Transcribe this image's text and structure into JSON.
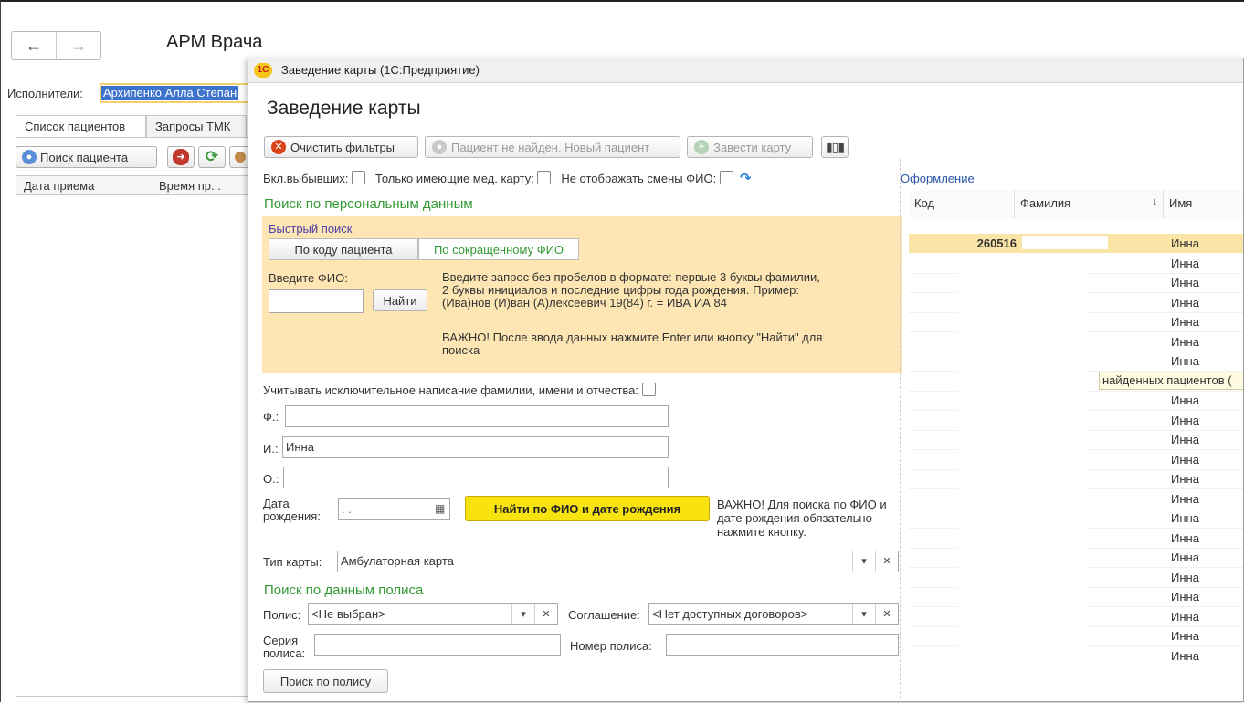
{
  "main": {
    "nav": {
      "back": "←",
      "forward": "→"
    },
    "title": "АРМ Врача",
    "executor": {
      "label": "Исполнители:",
      "value": "Архипенко Алла Степан"
    },
    "tabs": [
      "Список пациентов",
      "Запросы ТМК"
    ],
    "toolbar": {
      "find_patient": "Поиск пациента"
    },
    "grid": {
      "columns": [
        "Дата приема",
        "Время пр..."
      ]
    }
  },
  "dialog": {
    "window_title": "Заведение карты (1С:Предприятие)",
    "logo": "1С",
    "heading": "Заведение карты",
    "toolbar": {
      "clear_filters": "Очистить фильтры",
      "new_patient": "Пациент не найден. Новый пациент",
      "create_card": "Завести карту"
    },
    "filters": {
      "include_dropouts": "Вкл.выбывших:",
      "only_with_card": "Только имеющие мед. карту:",
      "hide_name_changes": "Не отображать смены ФИО:"
    },
    "personal_section": "Поиск по персональным данным",
    "quick_search": {
      "title": "Быстрый поиск",
      "tab_by_code": "По коду пациента",
      "tab_by_short_name": "По сокращенному ФИО",
      "enter_label": "Введите ФИО:",
      "find_button": "Найти",
      "hint": "Введите запрос без пробелов в формате: первые 3 буквы фамилии, 2 буквы инициалов и последние цифры года рождения. Пример: (Ива)нов (И)ван (А)лексеевич 19(84) г. = ИВА ИА 84",
      "important": "ВАЖНО! После ввода данных нажмите Enter или кнопку \"Найти\" для поиска"
    },
    "exact_spelling": "Учитывать исключительное написание фамилии, имени и отчества:",
    "fields": {
      "surname_label": "Ф.:",
      "surname_value": "",
      "name_label": "И.:",
      "name_value": "Инна",
      "patronymic_label": "О.:",
      "patronymic_value": ""
    },
    "birth": {
      "label": "Дата рождения:",
      "placeholder": " .  .",
      "search_button": "Найти по ФИО и дате рождения",
      "note": "ВАЖНО! Для поиска по ФИО и дате рождения обязательно нажмите кнопку."
    },
    "card_type": {
      "label": "Тип карты:",
      "value": "Амбулаторная карта"
    },
    "policy_section": "Поиск по данным полиса",
    "policy": {
      "label": "Полис:",
      "value": "<Не выбран>",
      "agreement_label": "Соглашение:",
      "agreement_value": "<Нет доступных договоров>",
      "series_label": "Серия полиса:",
      "number_label": "Номер полиса:",
      "search_button": "Поиск по полису"
    },
    "results": {
      "design_link": "Оформление",
      "columns": [
        "Код",
        "Фамилия",
        "Имя"
      ],
      "first_code": "260516",
      "names": [
        "Инна",
        "Инна",
        "Инна",
        "Инна",
        "Инна",
        "Инна",
        "Инна",
        "Инна",
        "Инна",
        "Инна",
        "Инна",
        "Инна",
        "Инна",
        "Инна",
        "Инна",
        "Инна",
        "Инна",
        "Инна",
        "Инна",
        "Инна",
        "Инна",
        "Инна"
      ],
      "tooltip": "найденных пациентов ("
    },
    "colors": {
      "accent": "#f8e20f",
      "highlight": "#fde6b4",
      "green": "#339933",
      "selected_row": "#fbe5a6"
    }
  }
}
